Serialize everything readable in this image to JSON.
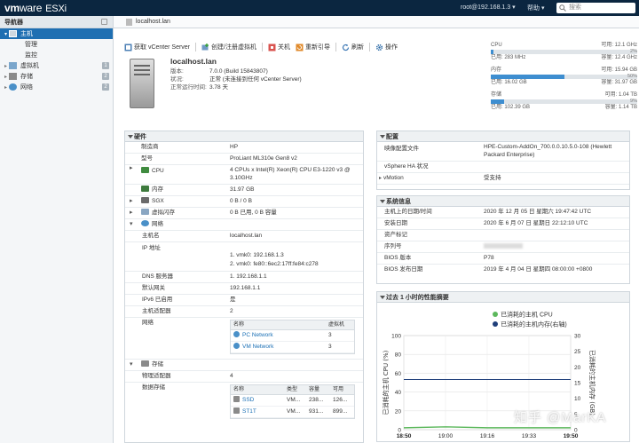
{
  "topbar": {
    "brand_vm": "vm",
    "brand_ware": "ware",
    "product": "ESXi",
    "user": "root@192.168.1.3",
    "help": "帮助",
    "search_placeholder": "搜索"
  },
  "nav": {
    "title": "导航器",
    "items": [
      {
        "label": "主机"
      },
      {
        "label": "管理"
      },
      {
        "label": "监控"
      },
      {
        "label": "虚拟机",
        "count": "1"
      },
      {
        "label": "存储",
        "count": "2"
      },
      {
        "label": "网络",
        "count": "2"
      }
    ]
  },
  "header": {
    "title": "localhost.lan"
  },
  "toolbar": {
    "vcenter": "获取 vCenter Server",
    "create": "创建/注册虚拟机",
    "shutdown": "关机",
    "reboot": "重新引导",
    "refresh": "刷新",
    "actions": "操作"
  },
  "host": {
    "name": "localhost.lan",
    "version_label": "版本:",
    "version": "7.0.0 (Build 15843807)",
    "state_label": "状况:",
    "state": "正常 (未连接到任何 vCenter Server)",
    "uptime_label": "正常运行时间:",
    "uptime": "3.78 天"
  },
  "resources": {
    "cpu": {
      "label": "CPU",
      "free": "可用: 12.1 GHz",
      "pct": "2%",
      "used": "已用: 283 MHz",
      "cap": "容量: 12.4 GHz",
      "level": 0.02
    },
    "mem": {
      "label": "内存",
      "free": "可用: 15.94 GB",
      "pct": "50%",
      "used": "已用: 16.02 GB",
      "cap": "容量: 31.97 GB",
      "level": 0.5
    },
    "sto": {
      "label": "存储",
      "free": "可用: 1.04 TB",
      "pct": "9%",
      "used": "已用: 102.39 GB",
      "cap": "容量: 1.14 TB",
      "level": 0.09
    }
  },
  "hardware": {
    "title": "硬件",
    "manufacturer_k": "制造商",
    "manufacturer": "HP",
    "model_k": "型号",
    "model": "ProLiant ML310e Gen8 v2",
    "cpu_k": "CPU",
    "cpu": "4 CPUs x Intel(R) Xeon(R) CPU E3-1220 v3 @ 3.10GHz",
    "mem_k": "内存",
    "mem": "31.97 GB",
    "sgx_k": "SGX",
    "sgx": "0 B / 0 B",
    "vflash_k": "虚拟闪存",
    "vflash": "0 B 已用, 0 B 容量",
    "net_k": "网络",
    "hostname_k": "主机名",
    "hostname": "localhost.lan",
    "ip_k": "IP 地址",
    "ip1": "1. vmk0: 192.168.1.3",
    "ip2": "2. vmk0: fe80::6ec2:17ff:fe84:c278",
    "dns_k": "DNS 服务器",
    "dns": "1. 192.168.1.1",
    "gw_k": "默认网关",
    "gw": "192.168.1.1",
    "ipv6_k": "IPv6 已启用",
    "ipv6": "是",
    "adapters_k": "主机适配器",
    "adapters": "2",
    "networks_k": "网络",
    "nettable": {
      "h_name": "名称",
      "h_vm": "虚拟机",
      "rows": [
        {
          "name": "PC Network",
          "vms": "3"
        },
        {
          "name": "VM Network",
          "vms": "3"
        }
      ]
    },
    "storage_k": "存储",
    "phys_k": "物理适配器",
    "phys": "4",
    "ds_k": "数据存储",
    "dstable": {
      "h_name": "名称",
      "h_type": "类型",
      "h_cap": "容量",
      "h_free": "可用",
      "rows": [
        {
          "name": "SSD",
          "type": "VM...",
          "cap": "238...",
          "free": "126..."
        },
        {
          "name": "ST1T",
          "type": "VM...",
          "cap": "931...",
          "free": "899..."
        }
      ]
    }
  },
  "config": {
    "title": "配置",
    "image_k": "映像配置文件",
    "image": "HPE-Custom-AddOn_700.0.0.10.5.0-108 (Hewlett Packard Enterprise)",
    "ha_k": "vSphere HA 状况",
    "ha": "",
    "vmotion_k": "vMotion",
    "vmotion": "受支持"
  },
  "sysinfo": {
    "title": "系统信息",
    "datetime_k": "主机上的日期/时间",
    "datetime": "2020 年 12 月 05 日 星期六 19:47:42 UTC",
    "install_k": "安装日期",
    "install": "2020 年 6 月 07 日 星期日 22:12:10 UTC",
    "asset_k": "资产标记",
    "asset": "",
    "serial_k": "序列号",
    "serial": "",
    "bios_k": "BIOS 版本",
    "bios": "P78",
    "biosdate_k": "BIOS 发布日期",
    "biosdate": "2019 年 4 月 04 日 星期四 08:00:00 +0800"
  },
  "perf": {
    "title": "过去 1 小时的性能摘要"
  },
  "chart_data": {
    "type": "line",
    "x": [
      "18:50",
      "19:00",
      "19:16",
      "19:33",
      "19:50"
    ],
    "series": [
      {
        "name": "已消耗的主机 CPU",
        "color": "#5cb85c",
        "axis": "left",
        "values": [
          2,
          3,
          2,
          2,
          2
        ]
      },
      {
        "name": "已消耗的主机内存(右轴)",
        "color": "#1f3f7a",
        "axis": "right",
        "values": [
          16,
          16,
          16,
          16,
          16
        ]
      }
    ],
    "ylabel": "已消耗的主机 CPU (%)",
    "y2label": "已消耗的主机内存 (GB)",
    "ylim": [
      0,
      100
    ],
    "y2lim": [
      0,
      30
    ],
    "yticks": [
      0,
      20,
      40,
      60,
      80,
      100
    ],
    "y2ticks": [
      0,
      5,
      10,
      15,
      20,
      25,
      30
    ],
    "grid": true,
    "legend": "top-right"
  },
  "watermark": {
    "text": "知乎 @MarKA"
  },
  "icons": {
    "host": "server-icon",
    "vm": "vm-icon",
    "storage": "storage-icon",
    "network": "network-icon"
  }
}
